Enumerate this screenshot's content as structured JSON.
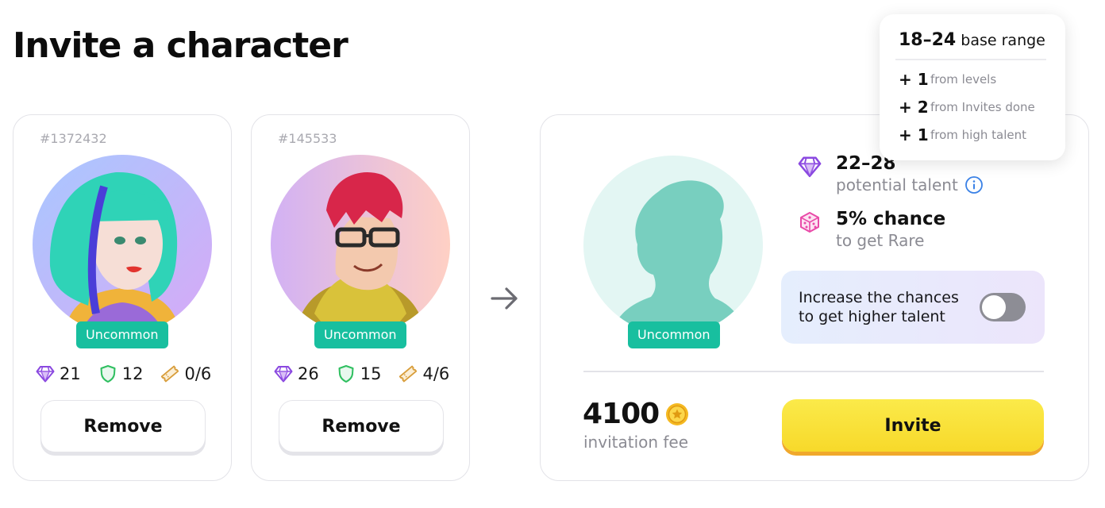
{
  "page": {
    "title": "Invite a character"
  },
  "colors": {
    "accent_green": "#18bf9f",
    "diamond_purple": "#8a48e0",
    "shield_green": "#2fbf60",
    "ticket_orange": "#d89d3a",
    "invite_yellow": "#f9e23c",
    "dice_pink": "#e94aa8",
    "info_blue": "#3b82e6"
  },
  "cards": [
    {
      "id": "#1372432",
      "rarity": "Uncommon",
      "avatar_icon": "teal-haired-woman-avatar",
      "stats": {
        "talent": "21",
        "defense": "12",
        "invites": "0/6"
      },
      "remove_label": "Remove"
    },
    {
      "id": "#145533",
      "rarity": "Uncommon",
      "avatar_icon": "red-haired-man-with-glasses-avatar",
      "stats": {
        "talent": "26",
        "defense": "15",
        "invites": "4/6"
      },
      "remove_label": "Remove"
    }
  ],
  "arrow_icon": "arrow-right-icon",
  "result": {
    "rarity": "Uncommon",
    "avatar_icon": "silhouette-avatar",
    "talent": {
      "range": "22–28",
      "label": "potential talent",
      "info_icon": "info-icon"
    },
    "rare": {
      "chance": "5% chance",
      "label": "to get Rare",
      "icon": "dice-icon"
    },
    "boost": {
      "text": "Increase the chances to get higher talent",
      "enabled": false
    },
    "fee": {
      "amount": "4100",
      "label": "invitation fee",
      "coin_icon": "coin-icon"
    },
    "invite_label": "Invite"
  },
  "tooltip": {
    "range": "18–24",
    "range_label": "base range",
    "rows": [
      {
        "value": "+ 1",
        "label": "from levels"
      },
      {
        "value": "+ 2",
        "label": "from Invites done"
      },
      {
        "value": "+ 1",
        "label": "from high talent"
      }
    ]
  }
}
